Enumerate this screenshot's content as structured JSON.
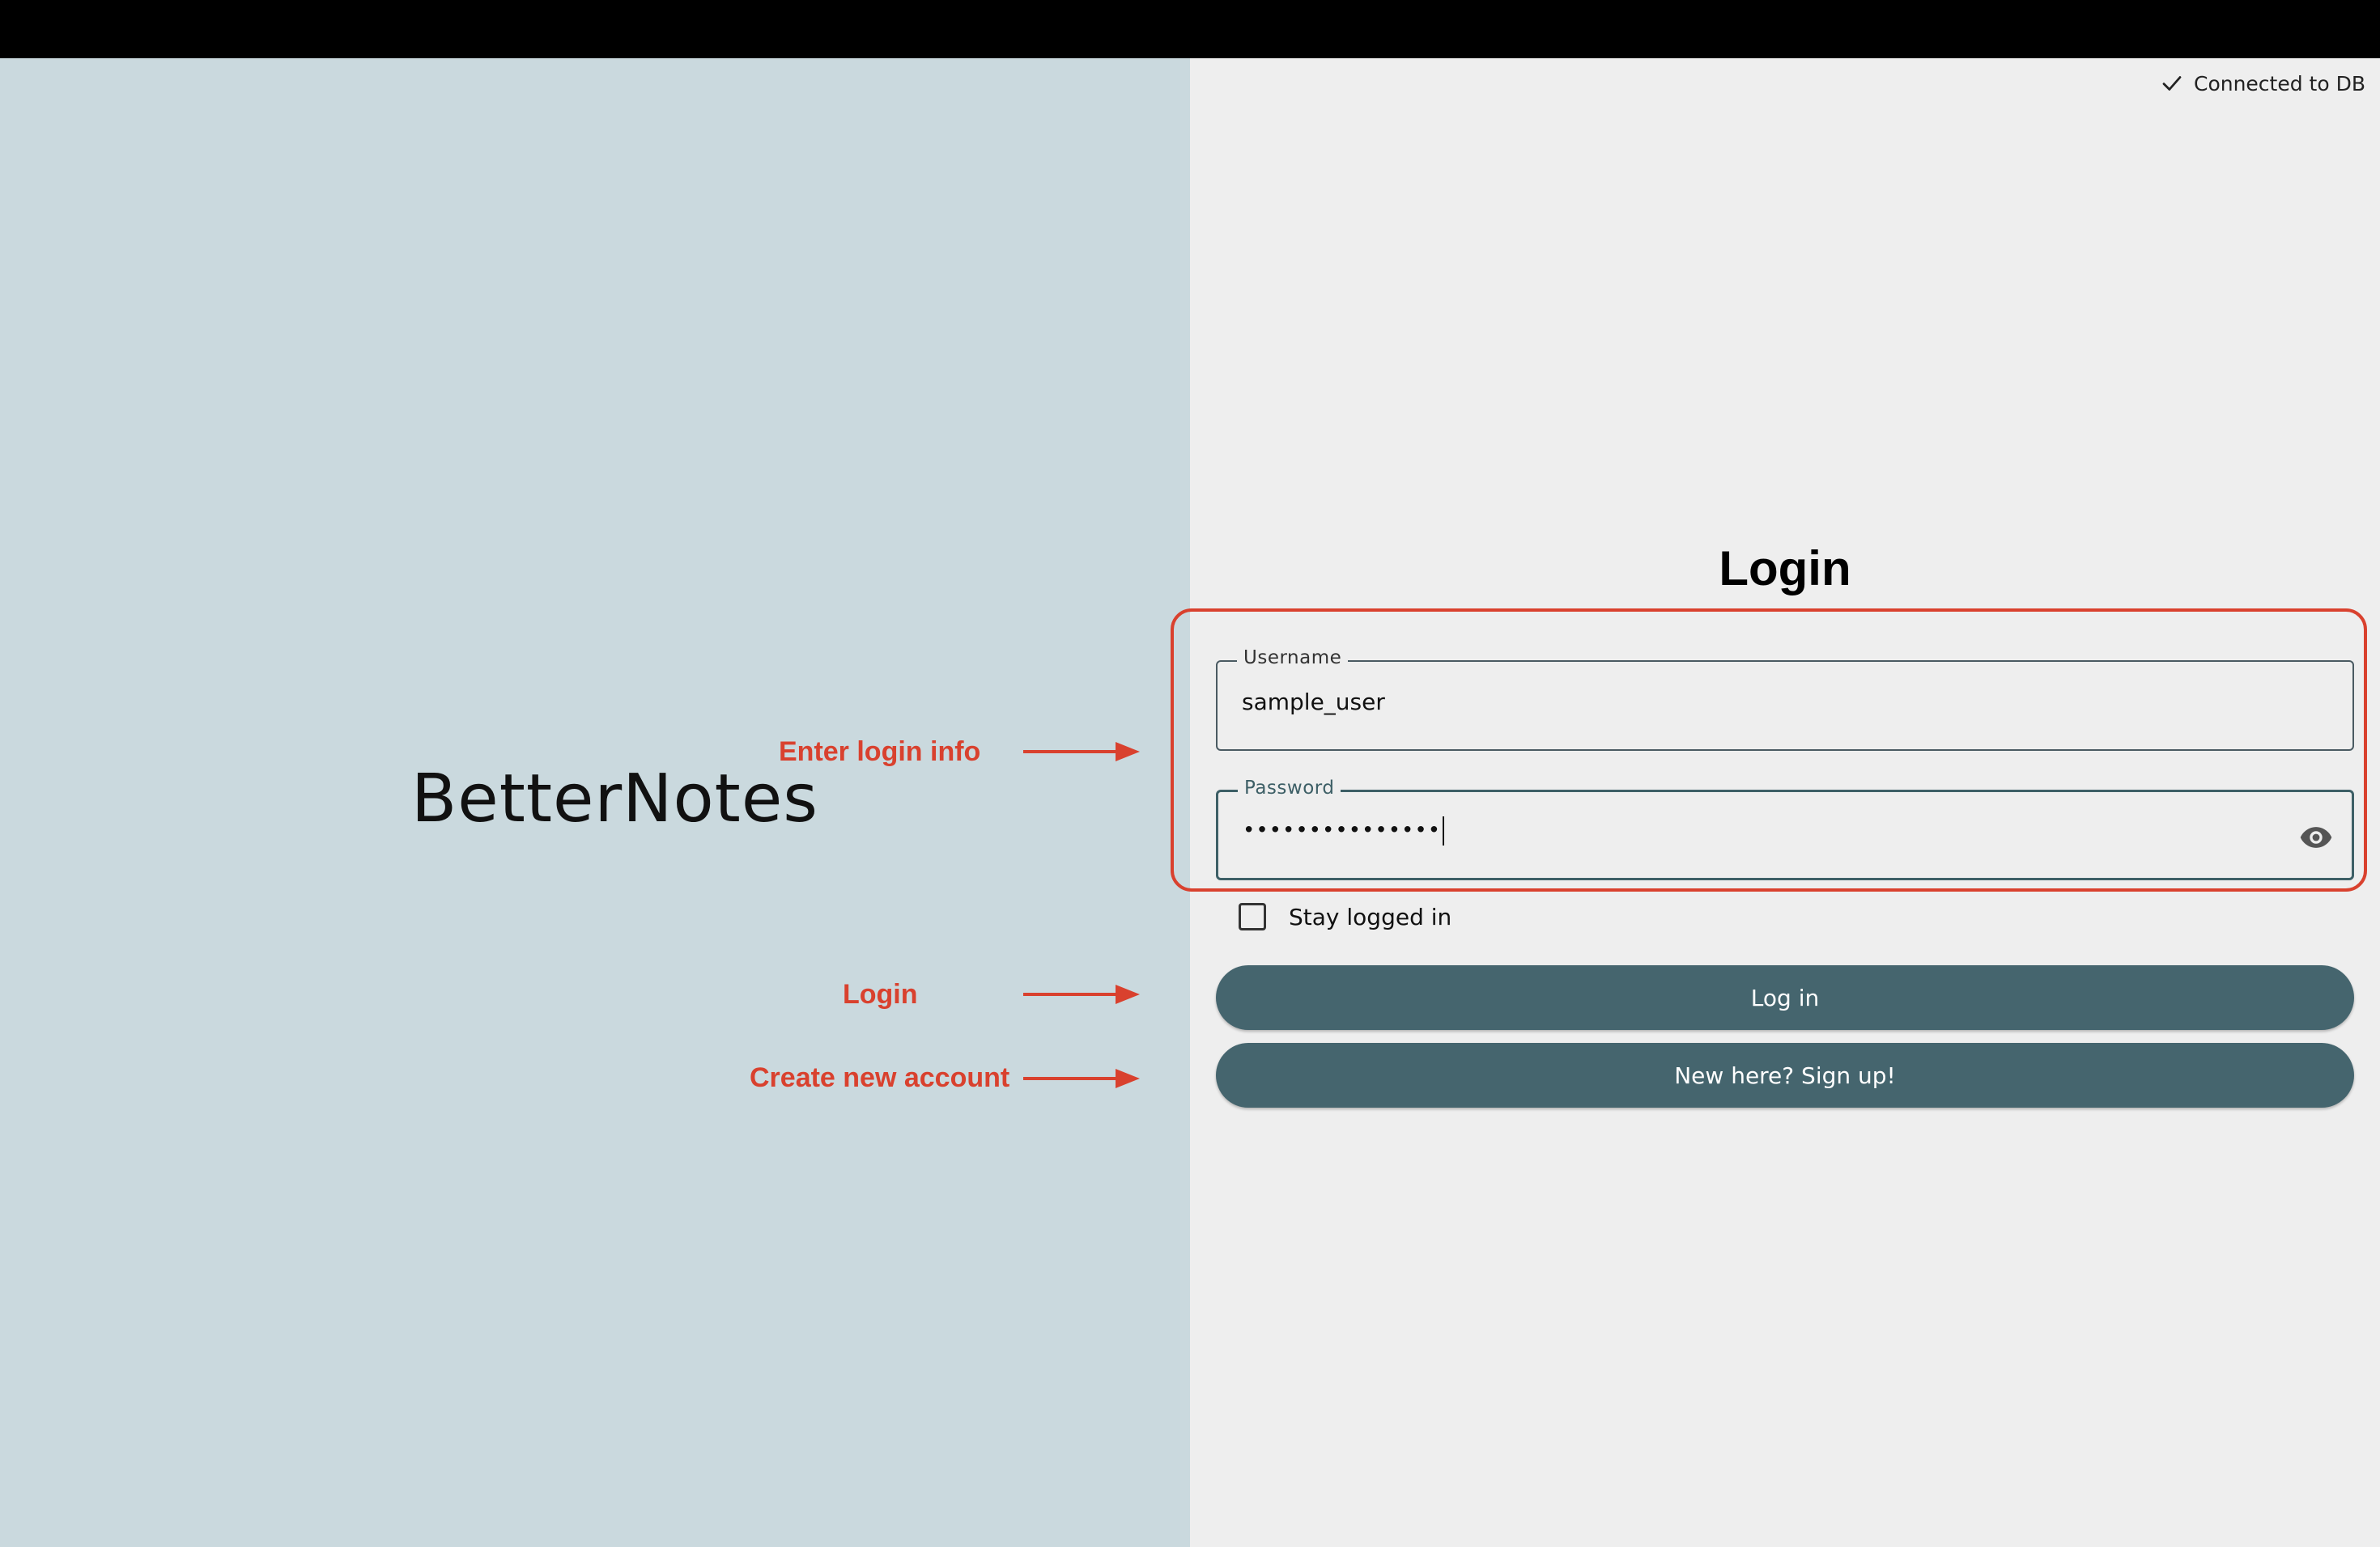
{
  "app": {
    "name": "BetterNotes"
  },
  "status": {
    "db_text": "Connected to DB",
    "icon": "checkmark-icon"
  },
  "login": {
    "title": "Login",
    "username": {
      "label": "Username",
      "value": "sample_user"
    },
    "password": {
      "label": "Password",
      "masked_value": "•••••••••••••••",
      "icon": "eye-icon"
    },
    "stay_logged_in": {
      "label": "Stay logged in",
      "checked": false
    },
    "login_button": "Log in",
    "signup_button": "New here? Sign up!"
  },
  "annotations": {
    "enter_login_info": "Enter login info",
    "login": "Login",
    "create_account": "Create new account",
    "color": "#d9412e"
  },
  "colors": {
    "left_panel": "#cad9de",
    "right_panel": "#eeeeee",
    "button": "#45656e",
    "accent": "#d9412e"
  }
}
